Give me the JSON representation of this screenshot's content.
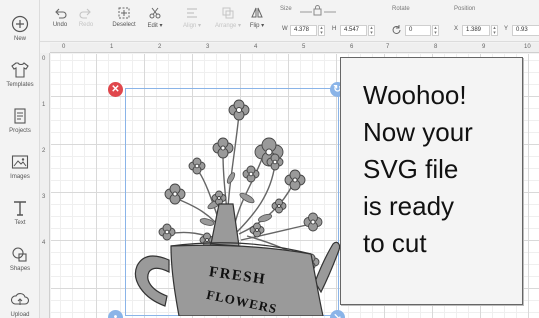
{
  "sidebar": {
    "items": [
      {
        "label": "New",
        "icon": "plus-circle-icon"
      },
      {
        "label": "Templates",
        "icon": "shirt-icon"
      },
      {
        "label": "Projects",
        "icon": "projects-icon"
      },
      {
        "label": "Images",
        "icon": "image-icon"
      },
      {
        "label": "Text",
        "icon": "text-icon"
      },
      {
        "label": "Shapes",
        "icon": "shapes-icon"
      },
      {
        "label": "Upload",
        "icon": "upload-icon"
      }
    ]
  },
  "toolbar": {
    "undo": "Undo",
    "redo": "Redo",
    "deselect": "Deselect",
    "edit": "Edit ▾",
    "align": "Align ▾",
    "arrange": "Arrange ▾",
    "flip": "Flip ▾",
    "size_label": "Size",
    "width_label": "W",
    "width_value": "4.378",
    "height_label": "H",
    "height_value": "4.547",
    "rotate_label": "Rotate",
    "rotate_value": "0",
    "position_label": "Position",
    "x_label": "X",
    "x_value": "1.389",
    "y_label": "Y",
    "y_value": "0.93"
  },
  "ruler": {
    "top": [
      "0",
      "1",
      "2",
      "3",
      "4",
      "5",
      "6",
      "7",
      "8",
      "9",
      "10"
    ],
    "left": [
      "0",
      "1",
      "2",
      "3",
      "4"
    ]
  },
  "design": {
    "text_line_1": "FRESH",
    "text_line_2": "FLOWERS"
  },
  "callout": {
    "lines": [
      "Woohoo!",
      "Now your",
      "SVG file",
      "is ready",
      "to cut"
    ]
  },
  "colors": {
    "accent_blue": "#8ab4e8",
    "delete_red": "#e0474c",
    "design_gray": "#9a9a9a"
  }
}
